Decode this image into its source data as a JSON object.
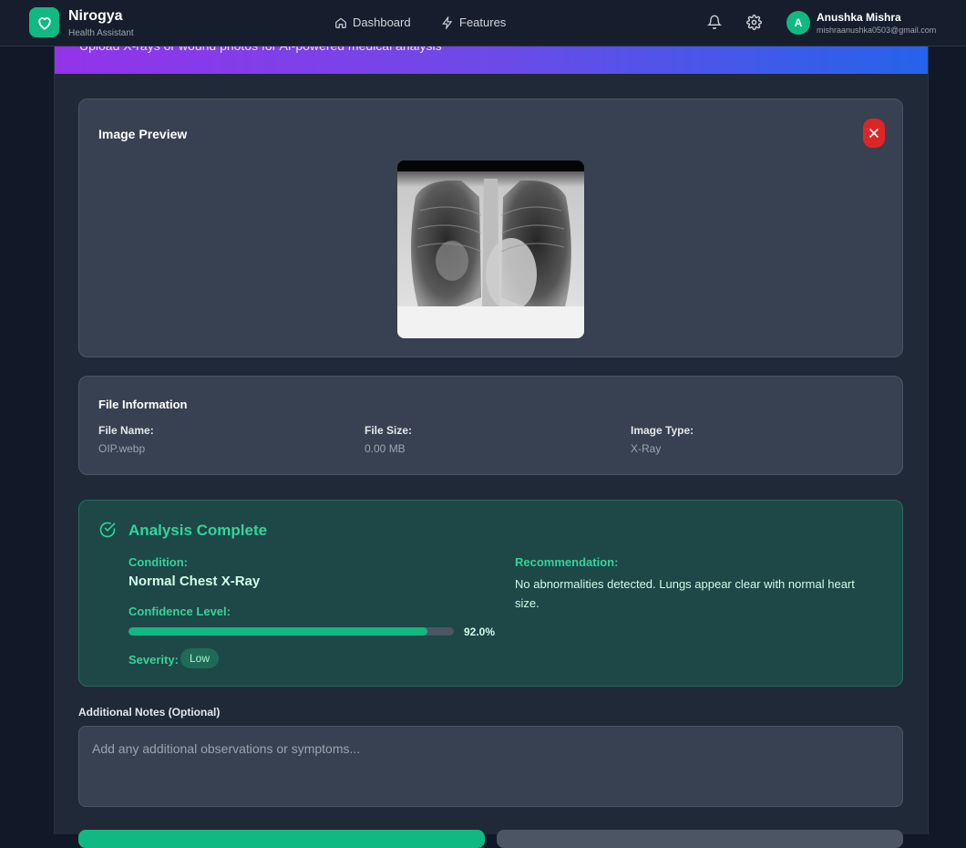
{
  "nav": {
    "brand": "Nirogya",
    "subtitle": "Health Assistant",
    "links": [
      {
        "label": "Dashboard",
        "icon": "home-icon"
      },
      {
        "label": "Features",
        "icon": "lightning-icon"
      }
    ],
    "icons": [
      "bell-icon",
      "gear-icon"
    ],
    "user": {
      "initial": "A",
      "name": "Anushka Mishra",
      "email": "mishraanushka0503@gmail.com"
    }
  },
  "banner": {
    "text": "Upload X-rays or wound photos for AI-powered medical analysis"
  },
  "preview": {
    "title": "Image Preview"
  },
  "file_info": {
    "title": "File Information",
    "name_label": "File Name:",
    "name_value": "OIP.webp",
    "size_label": "File Size:",
    "size_value": "0.00 MB",
    "type_label": "Image Type:",
    "type_value": "X-Ray"
  },
  "analysis": {
    "title": "Analysis Complete",
    "condition_label": "Condition:",
    "condition_value": "Normal Chest X-Ray",
    "confidence_label": "Confidence Level:",
    "confidence_value": "92.0%",
    "confidence_fraction": 0.92,
    "severity_label": "Severity:",
    "severity_value": "Low",
    "recommendation_label": "Recommendation:",
    "recommendation_text": "No abnormalities detected. Lungs appear clear with normal heart size."
  },
  "notes": {
    "label": "Additional Notes (Optional)",
    "placeholder": "Add any additional observations or symptoms..."
  },
  "colors": {
    "accent": "#10b981",
    "danger": "#dc2626",
    "banner_start": "#9333ea",
    "banner_end": "#2563eb"
  }
}
